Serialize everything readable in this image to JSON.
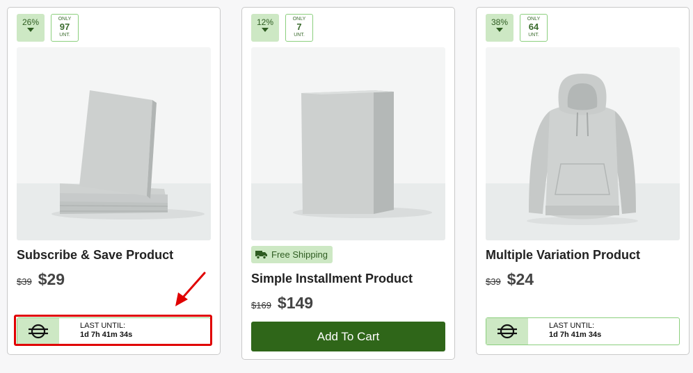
{
  "products": [
    {
      "discount": "26%",
      "stock_prefix": "ONLY",
      "stock_count": "97",
      "stock_unit": "UNT.",
      "title": "Subscribe & Save Product",
      "old_price": "$39",
      "price": "$29",
      "timer_label": "LAST UNTIL:",
      "countdown": "1d 7h 41m 34s"
    },
    {
      "discount": "12%",
      "stock_prefix": "ONLY",
      "stock_count": "7",
      "stock_unit": "UNT.",
      "badge": "Free Shipping",
      "title": "Simple Installment Product",
      "old_price": "$169",
      "price": "$149",
      "button": "Add To Cart"
    },
    {
      "discount": "38%",
      "stock_prefix": "ONLY",
      "stock_count": "64",
      "stock_unit": "UNT.",
      "title": "Multiple Variation Product",
      "old_price": "$39",
      "price": "$24",
      "timer_label": "LAST UNTIL:",
      "countdown": "1d 7h 41m 34s"
    }
  ],
  "icons": {
    "discount_down": "triangle-down-icon",
    "timer": "no-cash-icon",
    "shipping": "truck-icon"
  },
  "colors": {
    "accent": "#2f6619",
    "badge_bg": "#cde8c4",
    "highlight": "#e00000"
  }
}
